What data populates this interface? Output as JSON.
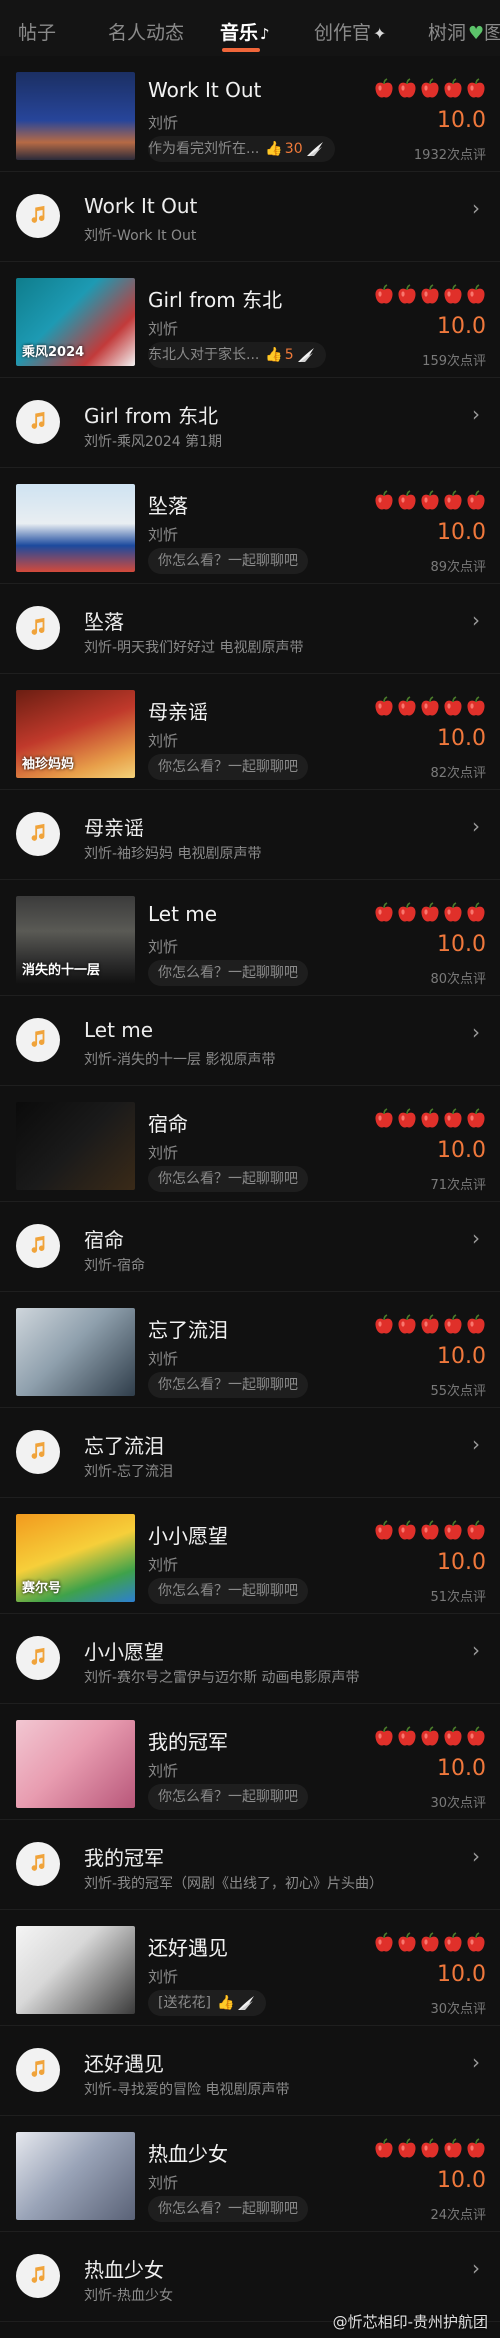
{
  "tabs": [
    {
      "label": "帖子",
      "active": false
    },
    {
      "label": "名人动态",
      "active": false
    },
    {
      "label": "音乐",
      "active": true
    },
    {
      "label": "创作官",
      "active": false
    },
    {
      "label": "树洞",
      "active": false
    },
    {
      "label": "图",
      "active": false
    }
  ],
  "colors": {
    "accent": "#f0663a",
    "score": "#f0783c",
    "background": "#111111"
  },
  "works": [
    {
      "title": "Work It Out",
      "artist": "刘忻",
      "comment": "作为看完刘忻在...",
      "likes": "30",
      "score": "10.0",
      "ratings": "1932次点评",
      "apples": 5,
      "thumb_text": "",
      "song": {
        "title": "Work It Out",
        "subtitle": "刘忻-Work It Out"
      }
    },
    {
      "title": "Girl from 东北",
      "artist": "刘忻",
      "comment": "东北人对于家长...",
      "likes": "5",
      "score": "10.0",
      "ratings": "159次点评",
      "apples": 5,
      "thumb_text": "乘风2024",
      "song": {
        "title": "Girl from 东北",
        "subtitle": "刘忻-乘风2024 第1期"
      }
    },
    {
      "title": "坠落",
      "artist": "刘忻",
      "comment": "你怎么看？一起聊聊吧",
      "likes": "",
      "score": "10.0",
      "ratings": "89次点评",
      "apples": 5,
      "thumb_text": "",
      "song": {
        "title": "坠落",
        "subtitle": "刘忻-明天我们好好过 电视剧原声带"
      }
    },
    {
      "title": "母亲谣",
      "artist": "刘忻",
      "comment": "你怎么看？一起聊聊吧",
      "likes": "",
      "score": "10.0",
      "ratings": "82次点评",
      "apples": 5,
      "thumb_text": "袖珍妈妈",
      "song": {
        "title": "母亲谣",
        "subtitle": "刘忻-袖珍妈妈 电视剧原声带"
      }
    },
    {
      "title": "Let me",
      "artist": "刘忻",
      "comment": "你怎么看？一起聊聊吧",
      "likes": "",
      "score": "10.0",
      "ratings": "80次点评",
      "apples": 5,
      "thumb_text": "消失的十一层",
      "song": {
        "title": "Let me",
        "subtitle": "刘忻-消失的十一层 影视原声带"
      }
    },
    {
      "title": "宿命",
      "artist": "刘忻",
      "comment": "你怎么看？一起聊聊吧",
      "likes": "",
      "score": "10.0",
      "ratings": "71次点评",
      "apples": 5,
      "thumb_text": "",
      "song": {
        "title": "宿命",
        "subtitle": "刘忻-宿命"
      }
    },
    {
      "title": "忘了流泪",
      "artist": "刘忻",
      "comment": "你怎么看？一起聊聊吧",
      "likes": "",
      "score": "10.0",
      "ratings": "55次点评",
      "apples": 5,
      "thumb_text": "",
      "song": {
        "title": "忘了流泪",
        "subtitle": "刘忻-忘了流泪"
      }
    },
    {
      "title": "小小愿望",
      "artist": "刘忻",
      "comment": "你怎么看？一起聊聊吧",
      "likes": "",
      "score": "10.0",
      "ratings": "51次点评",
      "apples": 5,
      "thumb_text": "赛尔号",
      "song": {
        "title": "小小愿望",
        "subtitle": "刘忻-赛尔号之雷伊与迈尔斯 动画电影原声带"
      }
    },
    {
      "title": "我的冠军",
      "artist": "刘忻",
      "comment": "你怎么看？一起聊聊吧",
      "likes": "",
      "score": "10.0",
      "ratings": "30次点评",
      "apples": 5,
      "thumb_text": "",
      "song": {
        "title": "我的冠军",
        "subtitle": "刘忻-我的冠军（网剧《出线了，初心》片头曲）"
      }
    },
    {
      "title": "还好遇见",
      "artist": "刘忻",
      "comment": "[送花花]",
      "likes": "",
      "score": "10.0",
      "ratings": "30次点评",
      "apples": 5,
      "thumb_text": "",
      "song": {
        "title": "还好遇见",
        "subtitle": "刘忻-寻找爱的冒险 电视剧原声带"
      }
    },
    {
      "title": "热血少女",
      "artist": "刘忻",
      "comment": "你怎么看？一起聊聊吧",
      "likes": "",
      "score": "10.0",
      "ratings": "24次点评",
      "apples": 5,
      "thumb_text": "",
      "song": {
        "title": "热血少女",
        "subtitle": "刘忻-热血少女"
      }
    }
  ],
  "watermark": "@忻芯相印-贵州护航团"
}
